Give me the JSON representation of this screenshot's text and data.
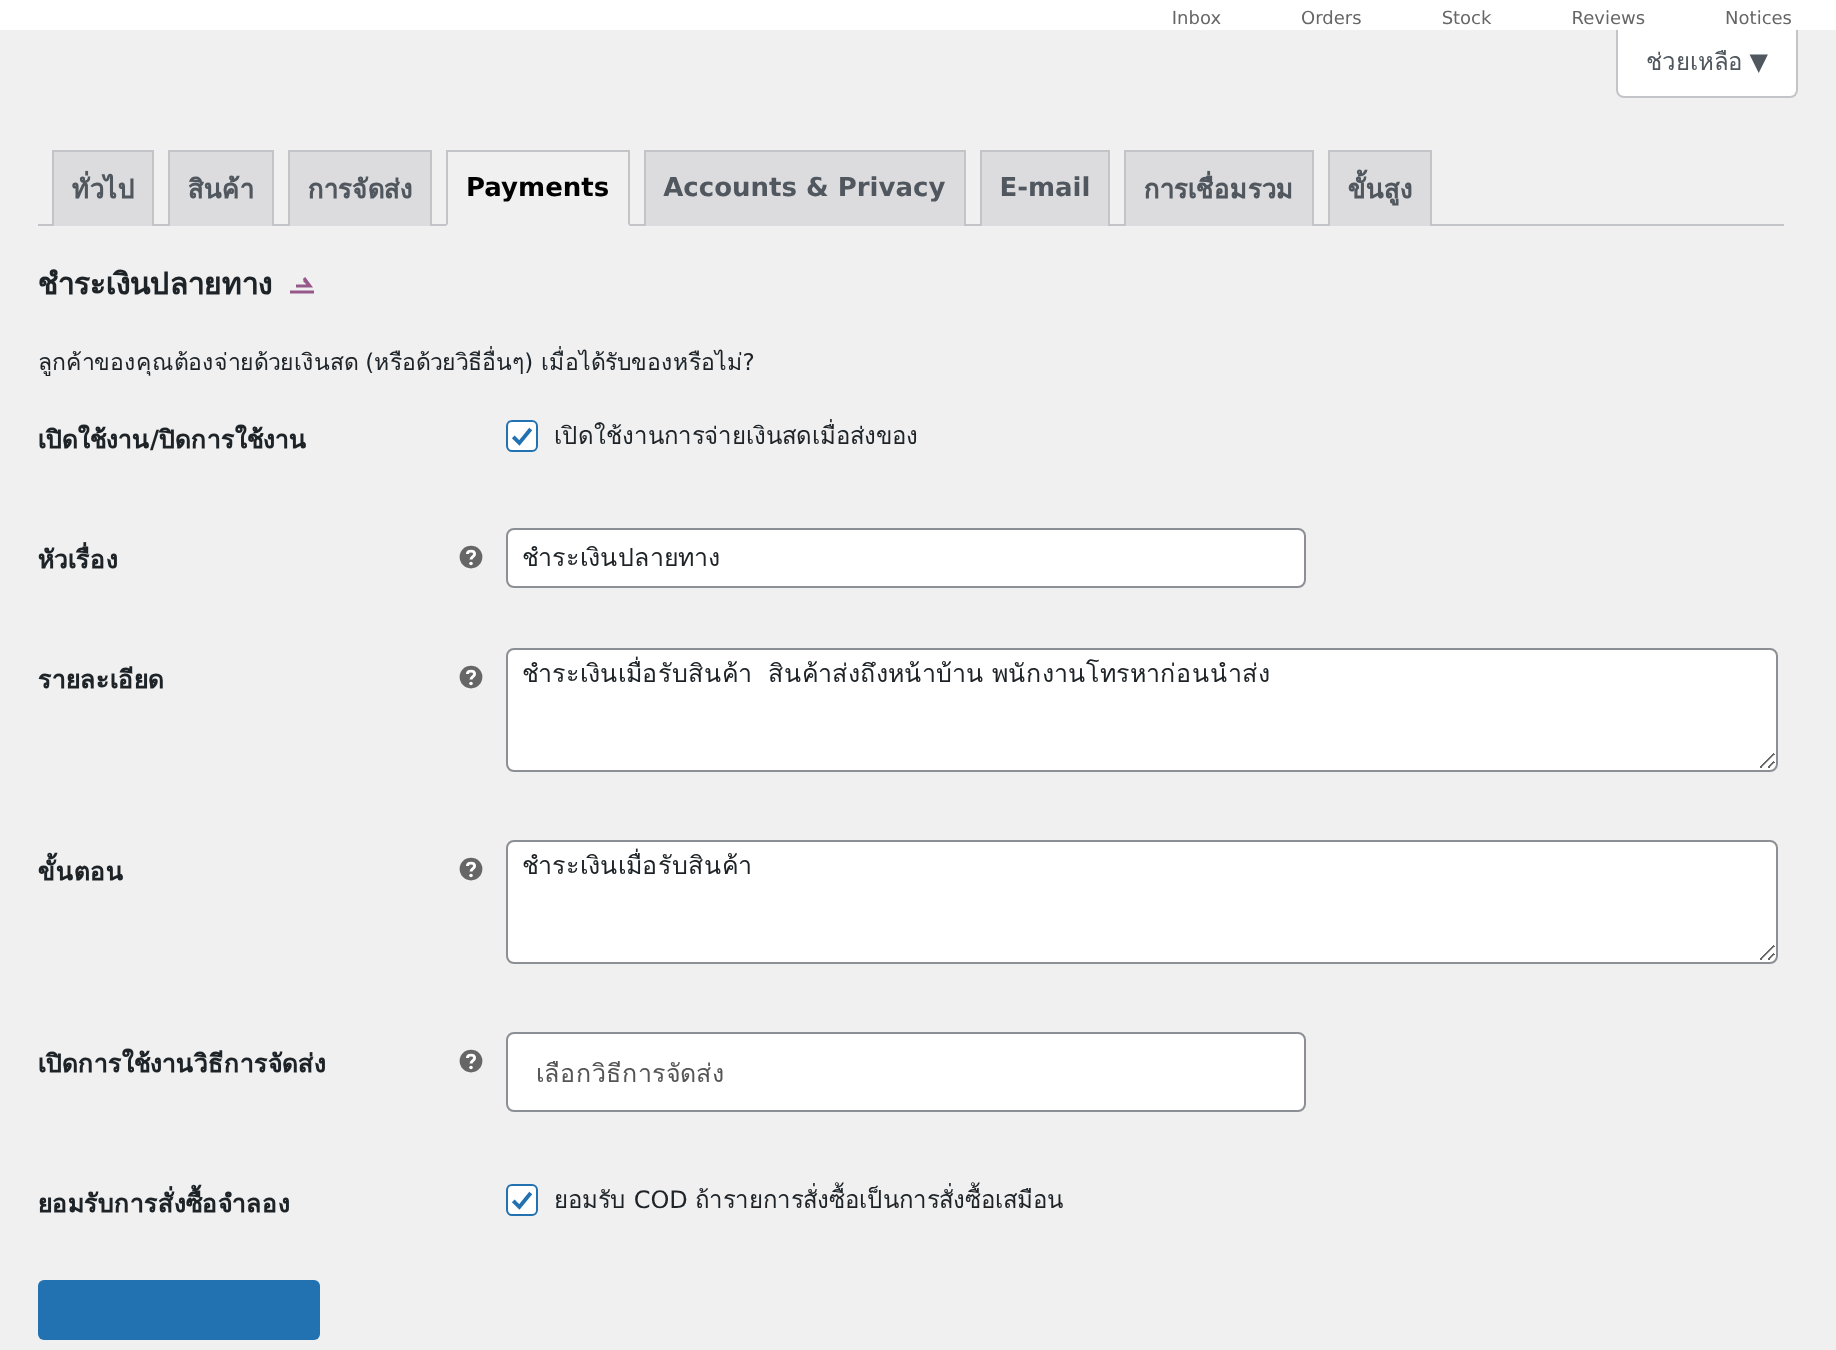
{
  "top_bar": {
    "items": [
      "Inbox",
      "Orders",
      "Stock",
      "Reviews",
      "Notices"
    ]
  },
  "help_button": {
    "label": "ช่วยเหลือ ▼"
  },
  "tabs": [
    {
      "label": "ทั่วไป",
      "selected": false
    },
    {
      "label": "สินค้า",
      "selected": false
    },
    {
      "label": "การจัดส่ง",
      "selected": false
    },
    {
      "label": "Payments",
      "selected": true
    },
    {
      "label": "Accounts & Privacy",
      "selected": false
    },
    {
      "label": "E-mail",
      "selected": false
    },
    {
      "label": "การเชื่อมรวม",
      "selected": false
    },
    {
      "label": "ขั้นสูง",
      "selected": false
    }
  ],
  "section": {
    "title": "ชำระเงินปลายทาง",
    "description": "ลูกค้าของคุณต้องจ่ายด้วยเงินสด (หรือด้วยวิธีอื่นๆ) เมื่อได้รับของหรือไม่?"
  },
  "fields": [
    {
      "kind": "checkbox",
      "label": "เปิดใช้งาน/ปิดการใช้งาน",
      "help": false,
      "checked": true,
      "text": "เปิดใช้งานการจ่ายเงินสดเมื่อส่งของ"
    },
    {
      "kind": "text",
      "label": "หัวเรื่อง",
      "help": true,
      "value": "ชำระเงินปลายทาง"
    },
    {
      "kind": "textarea",
      "label": "รายละเอียด",
      "help": true,
      "value": "ชำระเงินเมื่อรับสินค้า  สินค้าส่งถึงหน้าบ้าน พนักงานโทรหาก่อนนำส่ง"
    },
    {
      "kind": "textarea",
      "label": "ขั้นตอน",
      "help": true,
      "value": "ชำระเงินเมื่อรับสินค้า"
    },
    {
      "kind": "select",
      "label": "เปิดการใช้งานวิธีการจัดส่ง",
      "help": true,
      "placeholder": "เลือกวิธีการจัดส่ง"
    },
    {
      "kind": "checkbox",
      "label": "ยอมรับการสั่งซื้อจำลอง",
      "help": false,
      "checked": true,
      "text": "ยอมรับ COD ถ้ารายการสั่งซื้อเป็นการสั่งซื้อเสมือน"
    }
  ]
}
